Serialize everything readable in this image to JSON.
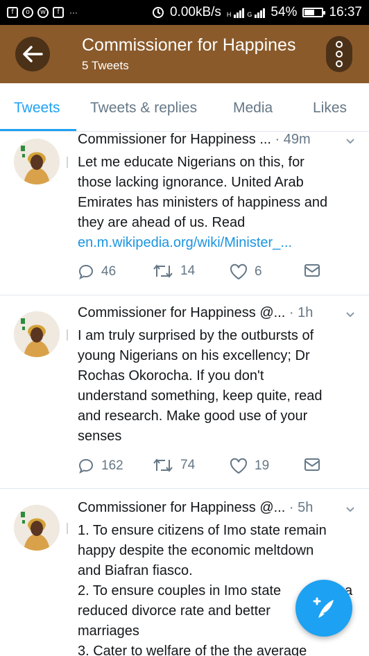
{
  "status_bar": {
    "speed": "0.00kB/s",
    "battery": "54%",
    "time": "16:37",
    "network_a": "H",
    "network_b": "G"
  },
  "header": {
    "title": "Commissioner for Happines",
    "subtitle": "5 Tweets"
  },
  "tabs": [
    {
      "label": "Tweets",
      "active": true
    },
    {
      "label": "Tweets & replies",
      "active": false
    },
    {
      "label": "Media",
      "active": false
    },
    {
      "label": "Likes",
      "active": false
    }
  ],
  "tweets": [
    {
      "author": "Commissioner for Happiness ...",
      "time": "· 49m",
      "lines": [
        "Let me educate Nigerians on this, for",
        "those lacking ignorance. United Arab",
        "Emirates has ministers of happiness and",
        "they are ahead of us. Read"
      ],
      "link": "en.m.wikipedia.org/wiki/Minister_...",
      "replies": "46",
      "retweets": "14",
      "likes": "6"
    },
    {
      "author": "Commissioner for Happiness @...",
      "time": "· 1h",
      "lines": [
        "I am truly surprised by the outbursts of",
        "young  Nigerians on his excellency; Dr",
        "Rochas Okorocha. If you don't",
        "understand  something, keep quite, read",
        "and research. Make good use of your",
        "senses"
      ],
      "replies": "162",
      "retweets": "74",
      "likes": "19"
    },
    {
      "author": "Commissioner for Happiness @...",
      "time": "· 5h",
      "lines": [
        "1. To ensure citizens of Imo state remain",
        "happy despite the economic meltdown",
        "and Biafran fiasco.",
        "2. To ensure couples in Imo state",
        "reduced divorce rate and better",
        "marriages",
        "3.  Cater to welfare of the the average"
      ],
      "line4_tail": "a"
    }
  ],
  "colors": {
    "app_bar": "#8a5a2b",
    "app_bar_button": "#4b3117",
    "accent": "#1da1f2",
    "link": "#1b95e0",
    "secondary_text": "#657786"
  },
  "icons": {
    "back": "arrow-left-icon",
    "more": "more-vertical-icon",
    "reply": "reply-icon",
    "retweet": "retweet-icon",
    "like": "heart-icon",
    "dm": "envelope-icon",
    "compose": "compose-feather-icon"
  }
}
